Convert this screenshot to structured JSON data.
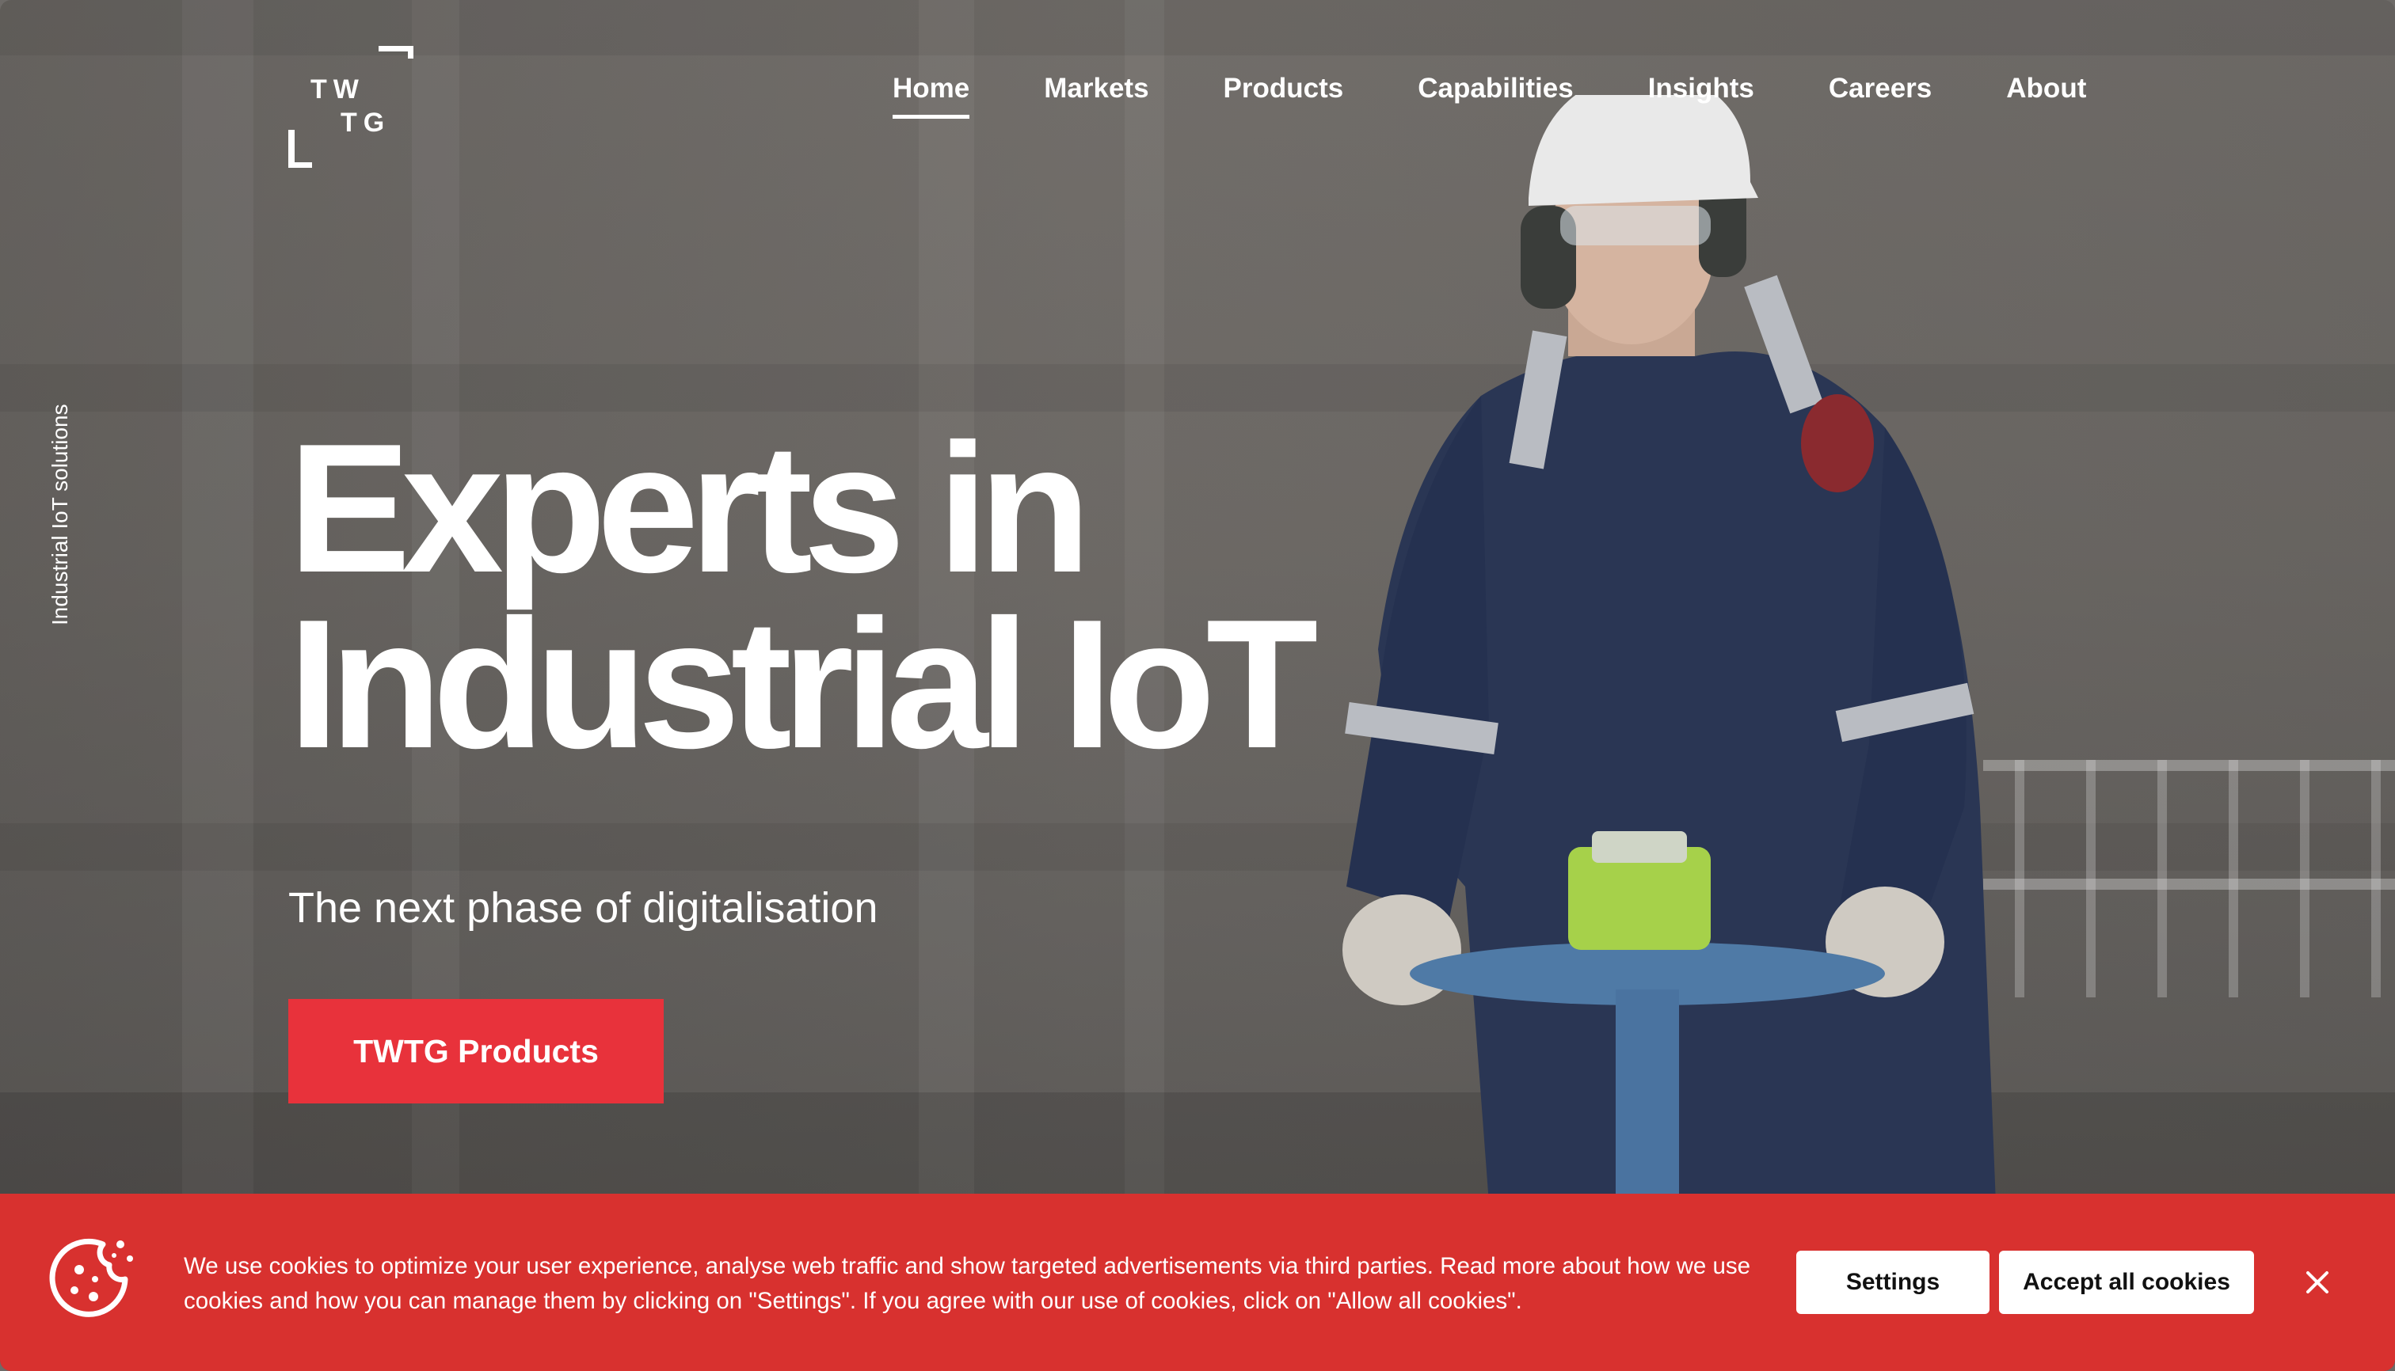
{
  "brand": {
    "logo_line1": "TW",
    "logo_line2": "TG"
  },
  "nav": {
    "items": [
      {
        "label": "Home",
        "active": true
      },
      {
        "label": "Markets",
        "active": false
      },
      {
        "label": "Products",
        "active": false
      },
      {
        "label": "Capabilities",
        "active": false
      },
      {
        "label": "Insights",
        "active": false
      },
      {
        "label": "Careers",
        "active": false
      },
      {
        "label": "About",
        "active": false
      }
    ]
  },
  "side_tag": "Industrial IoT solutions",
  "hero": {
    "title_line1": "Experts in",
    "title_line2": "Industrial IoT",
    "subtitle": "The next phase of digitalisation",
    "cta_label": "TWTG Products"
  },
  "cookie_banner": {
    "icon": "cookie-icon",
    "text": "We use cookies to optimize your user experience, analyse web traffic and show targeted advertisements via third parties. Read more about how we use cookies and how you can manage them by clicking on \"Settings\". If you agree with our use of cookies, click on \"Allow all cookies\".",
    "settings_label": "Settings",
    "accept_label": "Accept all cookies",
    "close_icon": "close-icon"
  },
  "colors": {
    "accent_red": "#e8323b",
    "banner_red": "#d8312f",
    "text_white": "#ffffff"
  }
}
